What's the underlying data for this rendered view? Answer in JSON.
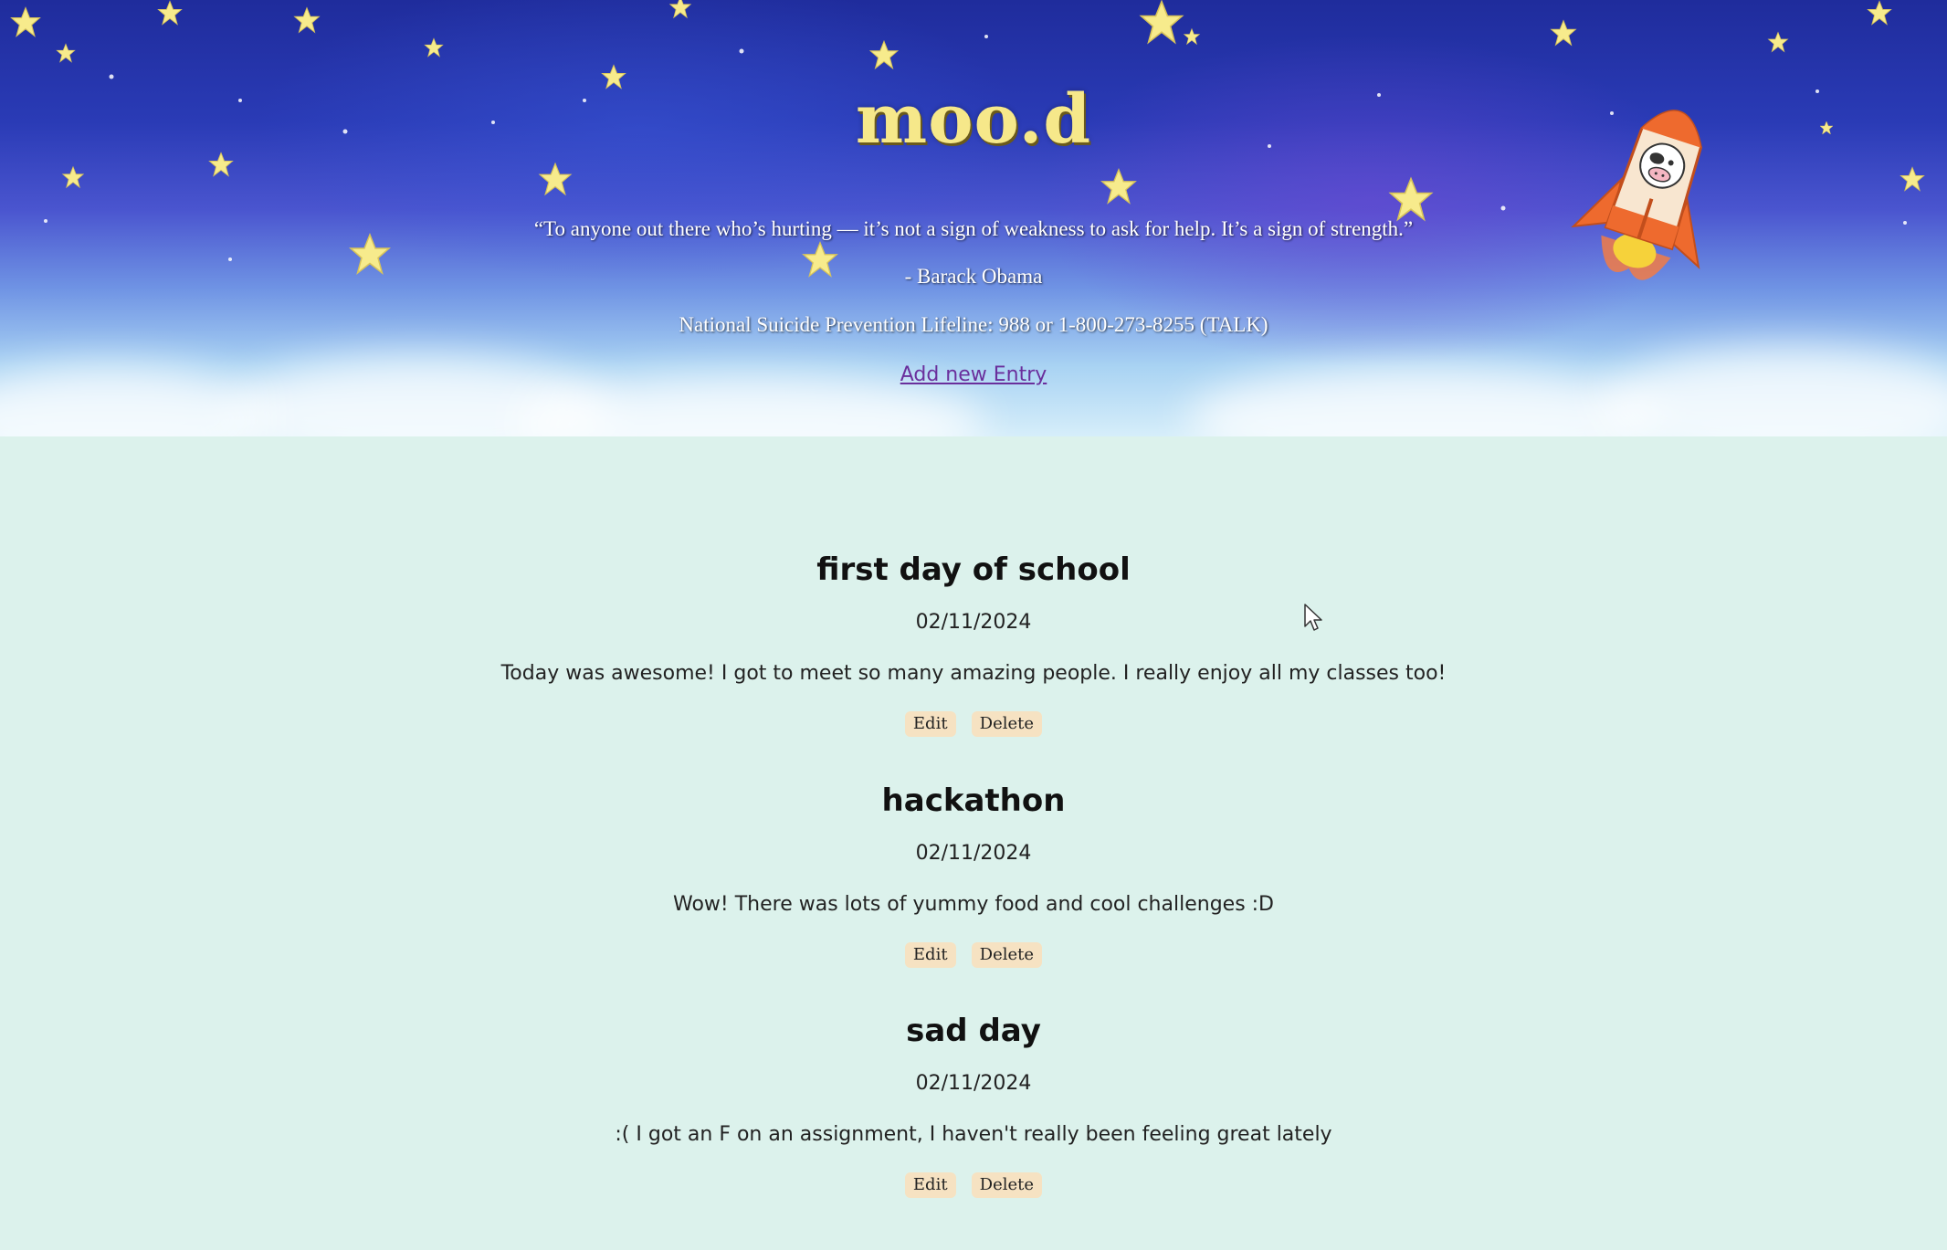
{
  "header": {
    "title": "moo.d",
    "quote": "“To anyone out there who’s hurting — it’s not a sign of weakness to ask for help. It’s a sign of strength.”",
    "author": "- Barack Obama",
    "lifeline": "National Suicide Prevention Lifeline: 988 or 1-800-273-8255 (TALK)",
    "add_entry_label": "Add new Entry"
  },
  "entries": [
    {
      "title": "first day of school",
      "date": "02/11/2024",
      "body": "Today was awesome! I got to meet so many amazing people. I really enjoy all my classes too!",
      "edit_label": "Edit",
      "delete_label": "Delete"
    },
    {
      "title": "hackathon",
      "date": "02/11/2024",
      "body": "Wow! There was lots of yummy food and cool challenges :D",
      "edit_label": "Edit",
      "delete_label": "Delete"
    },
    {
      "title": "sad day",
      "date": "02/11/2024",
      "body": ":( I got an F on an assignment, I haven't really been feeling great lately",
      "edit_label": "Edit",
      "delete_label": "Delete"
    }
  ],
  "colors": {
    "page_background": "#dcf2ec",
    "title_yellow": "#f6e88a",
    "button_bg": "#f6e2c2",
    "link_purple": "#6a2f9c"
  },
  "icons": {
    "stars": "star-icon",
    "rocket": "rocket-icon",
    "cursor": "mouse-cursor-icon"
  }
}
